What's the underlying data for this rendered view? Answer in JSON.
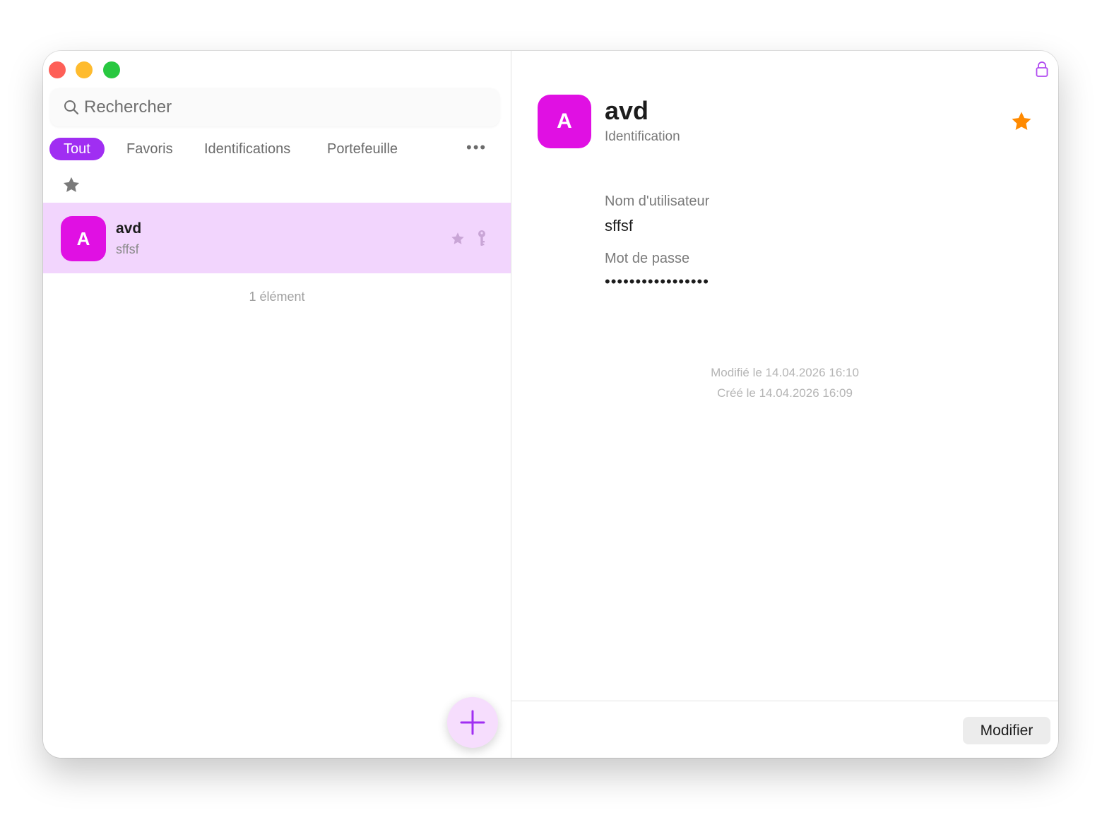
{
  "colors": {
    "accent": "#a02ef2",
    "avatar": "#e010e3",
    "selected_row": "#f2d5fd",
    "favorite_star": "#ff8a00",
    "fab_background": "#f6ddfd"
  },
  "window_controls": {
    "close_icon": "close-icon",
    "minimize_icon": "minimize-icon",
    "zoom_icon": "zoom-icon"
  },
  "search": {
    "placeholder": "Rechercher",
    "icon": "search-icon"
  },
  "tabs": [
    {
      "label": "Tout",
      "active": true
    },
    {
      "label": "Favoris",
      "active": false
    },
    {
      "label": "Identifications",
      "active": false
    },
    {
      "label": "Portefeuille",
      "active": false
    }
  ],
  "tabs_more": "•••",
  "list": {
    "items": [
      {
        "initial": "A",
        "title": "avd",
        "subtitle": "sffsf",
        "favorite": true,
        "type_icon": "key-icon"
      }
    ],
    "count_label": "1 élément"
  },
  "detail": {
    "initial": "A",
    "title": "avd",
    "type_label": "Identification",
    "favorite": true,
    "fields": [
      {
        "label": "Nom d'utilisateur",
        "value": "sffsf"
      },
      {
        "label": "Mot de passe",
        "value": "•••••••••••••••••"
      }
    ],
    "modified": "Modifié le 14.04.2026 16:10",
    "created": "Créé le 14.04.2026 16:09",
    "edit_button": "Modifier"
  }
}
